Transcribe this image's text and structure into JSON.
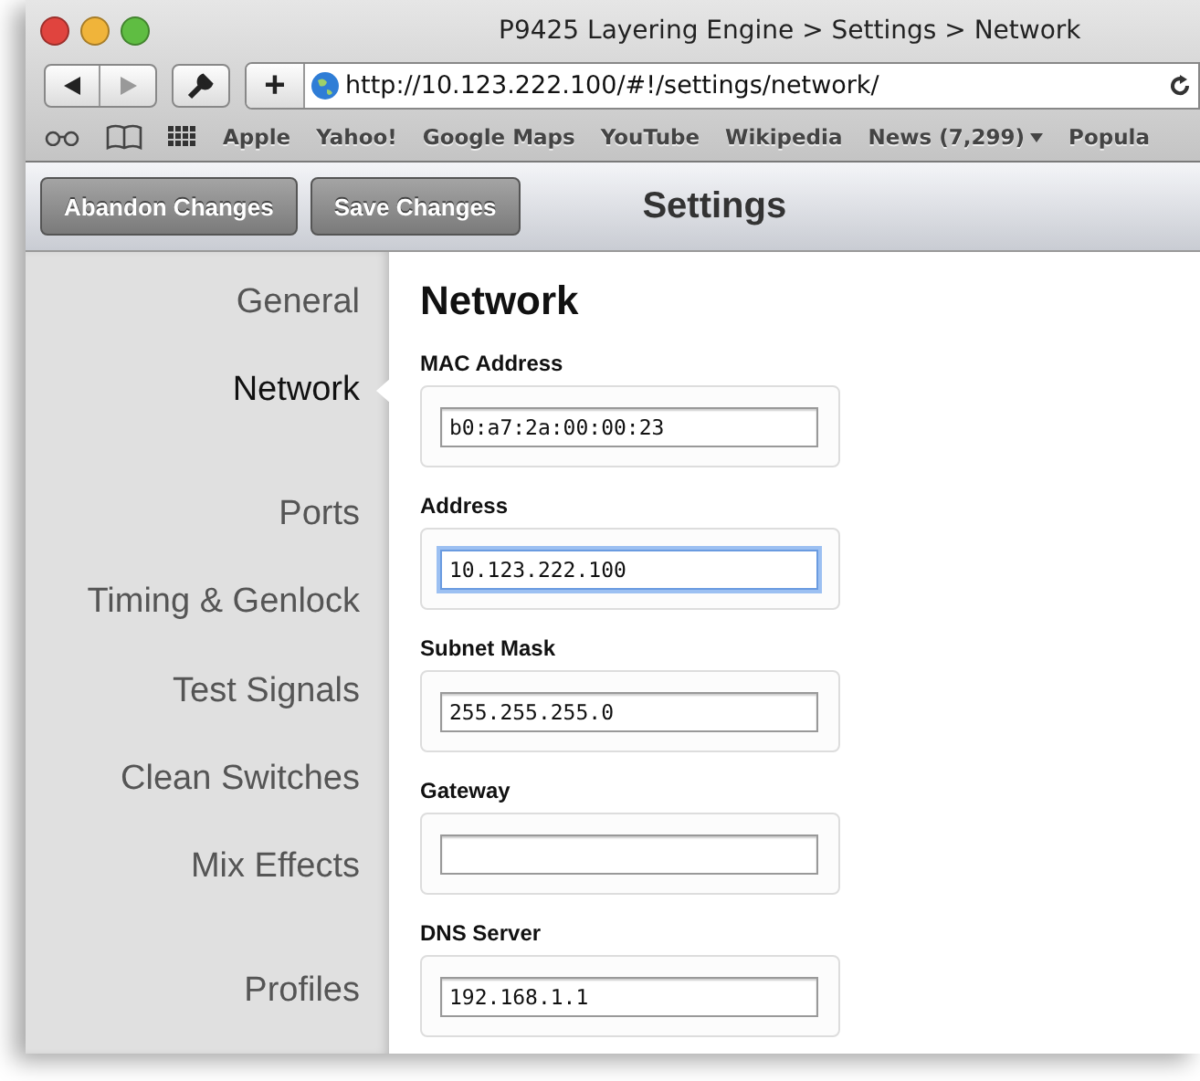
{
  "window": {
    "title": "P9425 Layering Engine > Settings > Network"
  },
  "address_bar": {
    "url": "http://10.123.222.100/#!/settings/network/"
  },
  "add_button": {
    "label": "+"
  },
  "bookmarks": [
    {
      "label": "Apple",
      "menu": false
    },
    {
      "label": "Yahoo!",
      "menu": false
    },
    {
      "label": "Google Maps",
      "menu": false
    },
    {
      "label": "YouTube",
      "menu": false
    },
    {
      "label": "Wikipedia",
      "menu": false
    },
    {
      "label": "News (7,299)",
      "menu": true
    },
    {
      "label": "Popula",
      "menu": false
    }
  ],
  "header": {
    "buttons": [
      "Abandon Changes",
      "Save Changes"
    ],
    "title": "Settings"
  },
  "sidebar": {
    "items": [
      {
        "label": "General",
        "selected": false
      },
      {
        "label": "Network",
        "selected": true
      },
      {
        "label": "Ports",
        "selected": false
      },
      {
        "label": "Timing & Genlock",
        "selected": false
      },
      {
        "label": "Test Signals",
        "selected": false
      },
      {
        "label": "Clean Switches",
        "selected": false
      },
      {
        "label": "Mix Effects",
        "selected": false
      },
      {
        "label": "Profiles",
        "selected": false
      }
    ]
  },
  "content": {
    "heading": "Network",
    "fields": [
      {
        "label": "MAC Address",
        "value": "b0:a7:2a:00:00:23",
        "focused": false
      },
      {
        "label": "Address",
        "value": "10.123.222.100",
        "focused": true
      },
      {
        "label": "Subnet Mask",
        "value": "255.255.255.0",
        "focused": false
      },
      {
        "label": "Gateway",
        "focused": false
      },
      {
        "label": "DNS Server",
        "value": "192.168.1.1",
        "focused": false
      }
    ]
  }
}
